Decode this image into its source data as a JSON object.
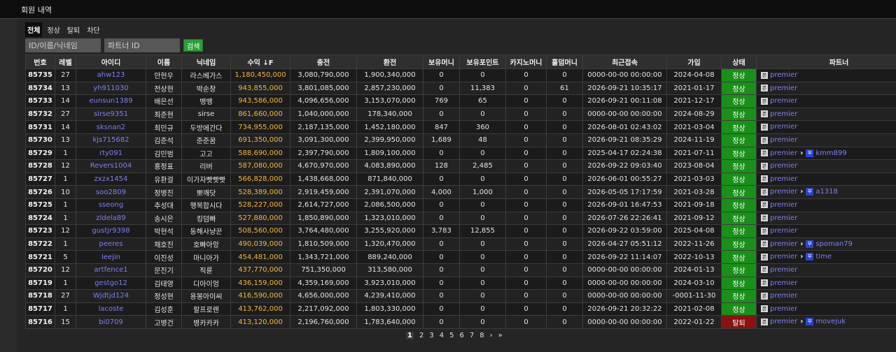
{
  "header": {
    "title": "회원 내역"
  },
  "tabs": [
    {
      "label": "전체",
      "active": true
    },
    {
      "label": "정상"
    },
    {
      "label": "탈퇴"
    },
    {
      "label": "차단"
    }
  ],
  "search": {
    "id_placeholder": "ID/이름/닉네임",
    "partner_placeholder": "파트너 ID",
    "button_label": "검색"
  },
  "table": {
    "columns": [
      "번호",
      "레벨",
      "아이디",
      "이름",
      "닉네임",
      "수익 ↓F",
      "충전",
      "환전",
      "보유머니",
      "보유포인트",
      "카지노머니",
      "홀덤머니",
      "최근접속",
      "가입",
      "상태",
      "파트너"
    ],
    "rows": [
      {
        "no": "85735",
        "level": "27",
        "id": "ahw123",
        "name": "안현우",
        "nick": "라스베가스",
        "profit": "1,180,450,000",
        "charge": "3,080,790,000",
        "exchange": "1,900,340,000",
        "money": "0",
        "point": "0",
        "casino": "0",
        "holdem": "0",
        "last": "0000-00-00 00:00:00",
        "joined": "2024-04-08",
        "status": "정상",
        "p1": "premier",
        "p2": ""
      },
      {
        "no": "85734",
        "level": "13",
        "id": "yh911030",
        "name": "전상현",
        "nick": "박순창",
        "profit": "943,855,000",
        "charge": "3,801,085,000",
        "exchange": "2,857,230,000",
        "money": "0",
        "point": "11,383",
        "casino": "0",
        "holdem": "61",
        "last": "2026-09-21 10:35:17",
        "joined": "2021-01-17",
        "status": "정상",
        "p1": "premier",
        "p2": ""
      },
      {
        "no": "85733",
        "level": "14",
        "id": "eunsun1389",
        "name": "배은선",
        "nick": "뱅뱅",
        "profit": "943,586,000",
        "charge": "4,096,656,000",
        "exchange": "3,153,070,000",
        "money": "769",
        "point": "65",
        "casino": "0",
        "holdem": "0",
        "last": "2026-09-21 00:11:08",
        "joined": "2021-12-17",
        "status": "정상",
        "p1": "premier",
        "p2": ""
      },
      {
        "no": "85732",
        "level": "27",
        "id": "sirse9351",
        "name": "최준현",
        "nick": "sirse",
        "profit": "861,660,000",
        "charge": "1,040,000,000",
        "exchange": "178,340,000",
        "money": "0",
        "point": "0",
        "casino": "0",
        "holdem": "0",
        "last": "0000-00-00 00:00:00",
        "joined": "2024-08-29",
        "status": "정상",
        "p1": "premier",
        "p2": ""
      },
      {
        "no": "85731",
        "level": "14",
        "id": "sksnan2",
        "name": "최민규",
        "nick": "두방에간다",
        "profit": "734,955,000",
        "charge": "2,187,135,000",
        "exchange": "1,452,180,000",
        "money": "847",
        "point": "360",
        "casino": "0",
        "holdem": "0",
        "last": "2026-08-01 02:43:02",
        "joined": "2021-03-04",
        "status": "정상",
        "p1": "premier",
        "p2": ""
      },
      {
        "no": "85730",
        "level": "13",
        "id": "kjs715682",
        "name": "김준석",
        "nick": "준준꿈",
        "profit": "691,350,000",
        "charge": "3,091,300,000",
        "exchange": "2,399,950,000",
        "money": "1,689",
        "point": "48",
        "casino": "0",
        "holdem": "0",
        "last": "2026-09-21 08:35:29",
        "joined": "2024-11-19",
        "status": "정상",
        "p1": "premier",
        "p2": ""
      },
      {
        "no": "85729",
        "level": "1",
        "id": "rty091",
        "name": "김민범",
        "nick": "고고",
        "profit": "588,690,000",
        "charge": "2,397,790,000",
        "exchange": "1,809,100,000",
        "money": "0",
        "point": "0",
        "casino": "0",
        "holdem": "0",
        "last": "2025-04-17 02:24:38",
        "joined": "2021-07-11",
        "status": "정상",
        "p1": "premier",
        "p2": "kmm899"
      },
      {
        "no": "85728",
        "level": "12",
        "id": "Revers1004",
        "name": "홍정표",
        "nick": "리버",
        "profit": "587,080,000",
        "charge": "4,670,970,000",
        "exchange": "4,083,890,000",
        "money": "128",
        "point": "2,485",
        "casino": "0",
        "holdem": "0",
        "last": "2026-09-22 09:03:40",
        "joined": "2023-08-04",
        "status": "정상",
        "p1": "premier",
        "p2": ""
      },
      {
        "no": "85727",
        "level": "1",
        "id": "zxzx1454",
        "name": "유환걸",
        "nick": "이가자빳빳빳",
        "profit": "566,828,000",
        "charge": "1,438,668,000",
        "exchange": "871,840,000",
        "money": "0",
        "point": "0",
        "casino": "0",
        "holdem": "0",
        "last": "2026-06-01 00:55:27",
        "joined": "2021-03-03",
        "status": "정상",
        "p1": "premier",
        "p2": ""
      },
      {
        "no": "85726",
        "level": "10",
        "id": "soo2809",
        "name": "정병진",
        "nick": "뽀깨닷",
        "profit": "528,389,000",
        "charge": "2,919,459,000",
        "exchange": "2,391,070,000",
        "money": "4,000",
        "point": "1,000",
        "casino": "0",
        "holdem": "0",
        "last": "2026-05-05 17:17:59",
        "joined": "2021-03-28",
        "status": "정상",
        "p1": "premier",
        "p2": "a1318"
      },
      {
        "no": "85725",
        "level": "1",
        "id": "sseong",
        "name": "추성대",
        "nick": "행복합시다",
        "profit": "528,227,000",
        "charge": "2,614,727,000",
        "exchange": "2,086,500,000",
        "money": "0",
        "point": "0",
        "casino": "0",
        "holdem": "0",
        "last": "2026-09-01 16:47:53",
        "joined": "2021-09-18",
        "status": "정상",
        "p1": "premier",
        "p2": ""
      },
      {
        "no": "85724",
        "level": "1",
        "id": "zldela89",
        "name": "송시은",
        "nick": "킹덤빠",
        "profit": "527,880,000",
        "charge": "1,850,890,000",
        "exchange": "1,323,010,000",
        "money": "0",
        "point": "0",
        "casino": "0",
        "holdem": "0",
        "last": "2026-07-26 22:26:41",
        "joined": "2021-09-12",
        "status": "정상",
        "p1": "premier",
        "p2": ""
      },
      {
        "no": "85723",
        "level": "12",
        "id": "gustjr9398",
        "name": "박현석",
        "nick": "동해사냥꾼",
        "profit": "508,560,000",
        "charge": "3,764,480,000",
        "exchange": "3,255,920,000",
        "money": "3,783",
        "point": "12,855",
        "casino": "0",
        "holdem": "0",
        "last": "2026-09-22 03:59:00",
        "joined": "2025-04-08",
        "status": "정상",
        "p1": "premier",
        "p2": ""
      },
      {
        "no": "85722",
        "level": "1",
        "id": "peeres",
        "name": "채호진",
        "nick": "호빠아앙",
        "profit": "490,039,000",
        "charge": "1,810,509,000",
        "exchange": "1,320,470,000",
        "money": "0",
        "point": "0",
        "casino": "0",
        "holdem": "0",
        "last": "2026-04-27 05:51:12",
        "joined": "2022-11-26",
        "status": "정상",
        "p1": "premier",
        "p2": "spoman79"
      },
      {
        "no": "85721",
        "level": "5",
        "id": "leejin",
        "name": "이진성",
        "nick": "마니아가",
        "profit": "454,481,000",
        "charge": "1,343,721,000",
        "exchange": "889,240,000",
        "money": "0",
        "point": "0",
        "casino": "0",
        "holdem": "0",
        "last": "2026-09-22 11:14:07",
        "joined": "2022-10-13",
        "status": "정상",
        "p1": "premier",
        "p2": "time"
      },
      {
        "no": "85720",
        "level": "12",
        "id": "artfence1",
        "name": "문진기",
        "nick": "직륜",
        "profit": "437,770,000",
        "charge": "751,350,000",
        "exchange": "313,580,000",
        "money": "0",
        "point": "0",
        "casino": "0",
        "holdem": "0",
        "last": "0000-00-00 00:00:00",
        "joined": "2024-01-13",
        "status": "정상",
        "p1": "premier",
        "p2": ""
      },
      {
        "no": "85719",
        "level": "1",
        "id": "gestgo12",
        "name": "김태영",
        "nick": "디아이엉",
        "profit": "436,159,000",
        "charge": "4,359,169,000",
        "exchange": "3,923,010,000",
        "money": "0",
        "point": "0",
        "casino": "0",
        "holdem": "0",
        "last": "0000-00-00 00:00:00",
        "joined": "2024-03-10",
        "status": "정상",
        "p1": "premier",
        "p2": ""
      },
      {
        "no": "85718",
        "level": "27",
        "id": "Wjdtjd124",
        "name": "정성현",
        "nick": "용봉아이씨",
        "profit": "416,590,000",
        "charge": "4,656,000,000",
        "exchange": "4,239,410,000",
        "money": "0",
        "point": "0",
        "casino": "0",
        "holdem": "0",
        "last": "0000-00-00 00:00:00",
        "joined": "-0001-11-30",
        "status": "정상",
        "p1": "premier",
        "p2": ""
      },
      {
        "no": "85717",
        "level": "1",
        "id": "lacoste",
        "name": "김성훈",
        "nick": "랄프로렌",
        "profit": "413,762,000",
        "charge": "2,217,092,000",
        "exchange": "1,803,330,000",
        "money": "0",
        "point": "0",
        "casino": "0",
        "holdem": "0",
        "last": "2026-09-21 20:32:22",
        "joined": "2021-02-08",
        "status": "정상",
        "p1": "premier",
        "p2": ""
      },
      {
        "no": "85716",
        "level": "15",
        "id": "bi0709",
        "name": "고병건",
        "nick": "병카카카",
        "profit": "413,120,000",
        "charge": "2,196,760,000",
        "exchange": "1,783,640,000",
        "money": "0",
        "point": "0",
        "casino": "0",
        "holdem": "0",
        "last": "0000-00-00 00:00:00",
        "joined": "2022-01-22",
        "status": "탈퇴",
        "p1": "premier",
        "p2": "movejuk"
      }
    ]
  },
  "badges": {
    "partner": "본",
    "sub": "부"
  },
  "pagination": {
    "pages": [
      "1",
      "2",
      "3",
      "4",
      "5",
      "6",
      "7",
      "8"
    ],
    "current": "1",
    "next": "›",
    "last": "»"
  },
  "colors": {
    "status_ok": "#1a8f1a",
    "status_left": "#8b1212",
    "link": "#7f7ff2",
    "profit": "#f0b840",
    "search_button": "#2d9e3a"
  }
}
